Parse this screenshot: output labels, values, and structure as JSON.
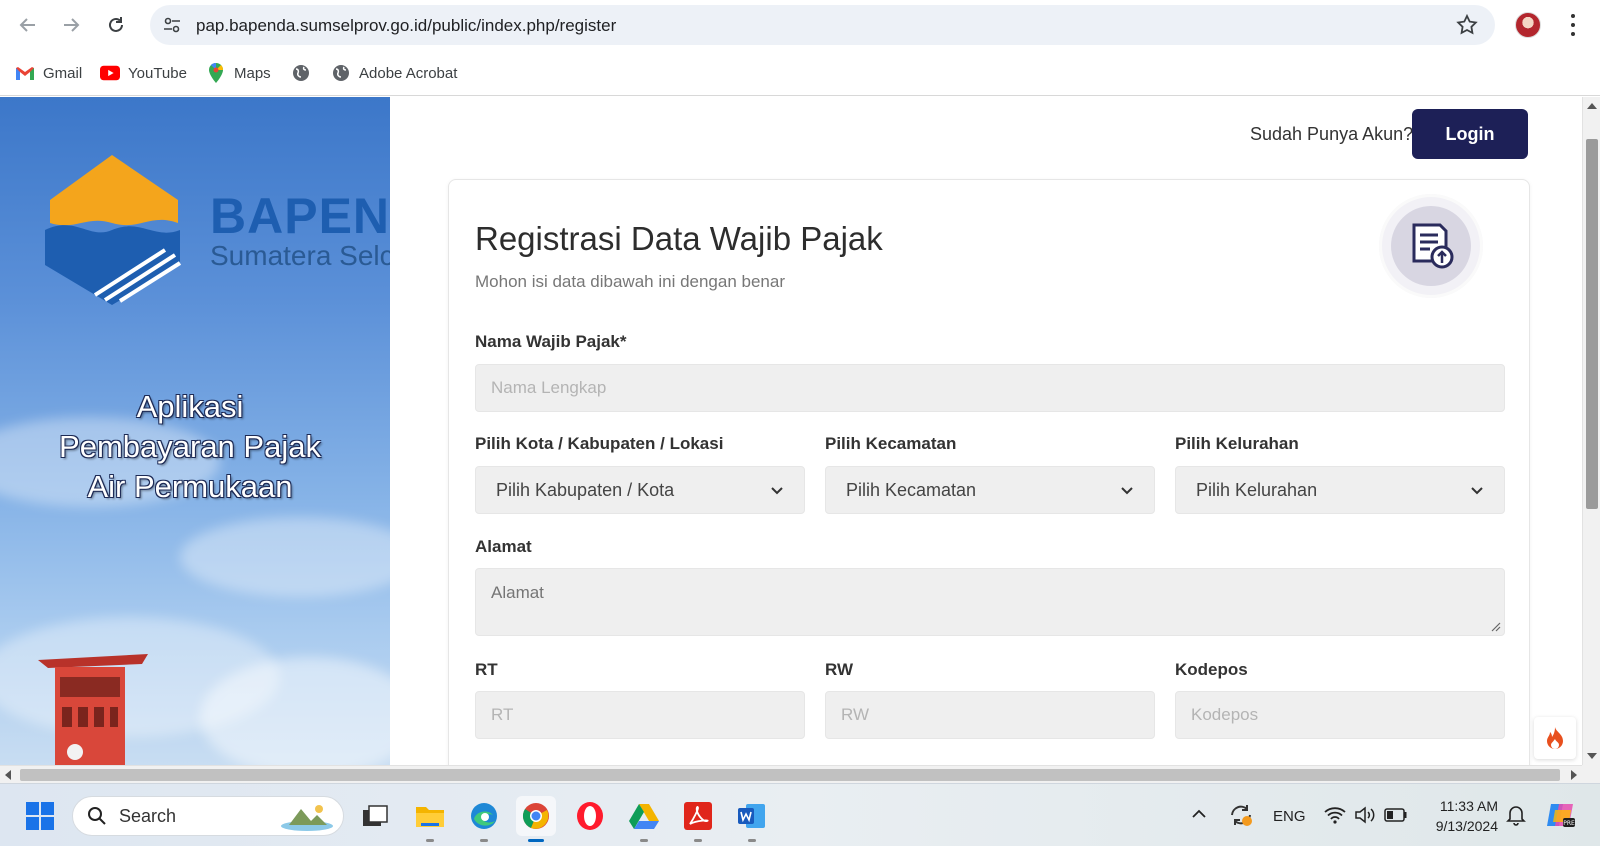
{
  "browser": {
    "url": "pap.bapenda.sumselprov.go.id/public/index.php/register",
    "bookmarks": [
      {
        "label": "Gmail",
        "icon": "gmail-icon"
      },
      {
        "label": "YouTube",
        "icon": "youtube-icon"
      },
      {
        "label": "Maps",
        "icon": "maps-icon"
      },
      {
        "label": "",
        "icon": "globe-icon"
      },
      {
        "label": "Adobe Acrobat",
        "icon": "globe-icon"
      }
    ]
  },
  "hero": {
    "brand_name": "BAPEND",
    "brand_region": "Sumatera Selc",
    "title_lines": [
      "Aplikasi",
      "Pembayaran Pajak",
      "Air Permukaan"
    ]
  },
  "header": {
    "have_account": "Sudah Punya Akun?",
    "login_label": "Login"
  },
  "form": {
    "title": "Registrasi Data Wajib Pajak",
    "subtitle": "Mohon isi data dibawah ini dengan benar",
    "name": {
      "label": "Nama Wajib Pajak*",
      "placeholder": "Nama Lengkap"
    },
    "kota": {
      "label": "Pilih Kota / Kabupaten / Lokasi",
      "value": "Pilih Kabupaten / Kota"
    },
    "kecamatan": {
      "label": "Pilih Kecamatan",
      "value": "Pilih Kecamatan"
    },
    "kelurahan": {
      "label": "Pilih Kelurahan",
      "value": "Pilih Kelurahan"
    },
    "alamat": {
      "label": "Alamat",
      "placeholder": "Alamat"
    },
    "rt": {
      "label": "RT",
      "placeholder": "RT"
    },
    "rw": {
      "label": "RW",
      "placeholder": "RW"
    },
    "kodepos": {
      "label": "Kodepos",
      "placeholder": "Kodepos"
    }
  },
  "taskbar": {
    "search_label": "Search",
    "language": "ENG",
    "time": "11:33 AM",
    "date": "9/13/2024"
  },
  "colors": {
    "login_button": "#1d2057",
    "brand_blue": "#1e5eb0",
    "brand_orange": "#f4a51c"
  }
}
